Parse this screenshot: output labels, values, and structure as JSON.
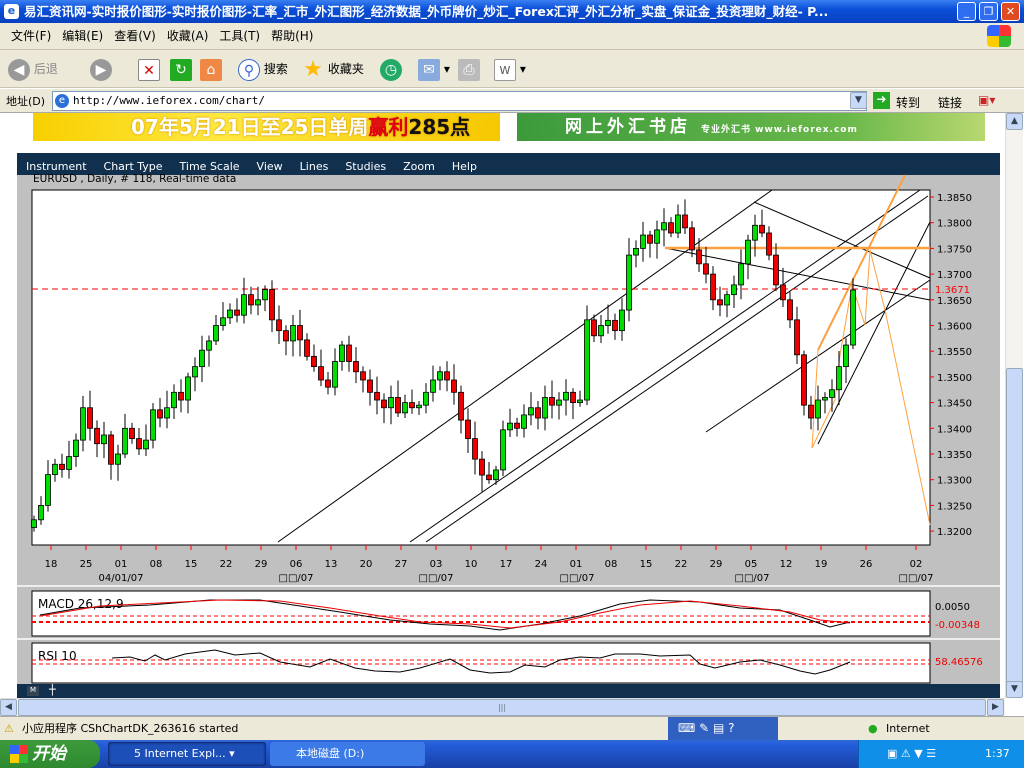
{
  "window": {
    "title": "易汇资讯网-实时报价图形-实时报价图形-汇率_汇市_外汇图形_经济数据_外币牌价_炒汇_Forex汇评_外汇分析_实盘_保证金_投资理财_财经- P...",
    "minimize": "_",
    "restore": "❐",
    "close": "✕"
  },
  "menu": [
    "文件(F)",
    "编辑(E)",
    "查看(V)",
    "收藏(A)",
    "工具(T)",
    "帮助(H)"
  ],
  "toolbar": {
    "back": "后退",
    "search": "搜索",
    "favorites": "收藏夹"
  },
  "address": {
    "label": "地址(D)",
    "url": "http://www.ieforex.com/chart/",
    "go": "转到",
    "links": "链接"
  },
  "banners": {
    "left_a": "07年5月21日至25日单周",
    "left_b": "赢利",
    "left_c": "285点",
    "right": "网上外汇书店",
    "right_small": "专业外汇书 www.ieforex.com"
  },
  "applet": {
    "menu": [
      "Instrument",
      "Chart Type",
      "Time Scale",
      "View",
      "Lines",
      "Studies",
      "Zoom",
      "Help"
    ],
    "info": "EURUSD , Daily, # 118, Real-time data",
    "current_price": "1.3671",
    "macd_label": "MACD 26,12,9",
    "macd_ticks": [
      "0.0050",
      "-0.00348"
    ],
    "rsi_label": "RSI 10",
    "rsi_value": "58.46576",
    "colors": {
      "up": "#00dd00",
      "down": "#ee0000",
      "fib": "#ffa040",
      "level": "#ff0000"
    }
  },
  "chart_data": {
    "type": "candlestick",
    "instrument": "EURUSD",
    "timeframe": "Daily",
    "ylim": [
      1.318,
      1.388
    ],
    "y_ticks": [
      "1.3850",
      "1.3800",
      "1.3750",
      "1.3700",
      "1.3650",
      "1.3600",
      "1.3550",
      "1.3500",
      "1.3450",
      "1.3400",
      "1.3350",
      "1.3300",
      "1.3250",
      "1.3200"
    ],
    "x_ticks": [
      "18",
      "25",
      "01",
      "08",
      "15",
      "22",
      "29",
      "06",
      "13",
      "20",
      "27",
      "03",
      "10",
      "17",
      "24",
      "01",
      "08",
      "15",
      "22",
      "29",
      "05",
      "12",
      "19",
      "26",
      "02"
    ],
    "x_month_labels": [
      "04/01/07",
      "□□/07",
      "□□/07",
      "□□/07",
      "□□/07",
      "□□/07"
    ],
    "closes": [
      1.3222,
      1.325,
      1.331,
      1.333,
      1.332,
      1.3345,
      1.3377,
      1.344,
      1.34,
      1.337,
      1.3387,
      1.333,
      1.335,
      1.34,
      1.338,
      1.336,
      1.3377,
      1.3436,
      1.342,
      1.344,
      1.347,
      1.3455,
      1.35,
      1.352,
      1.3552,
      1.357,
      1.36,
      1.3615,
      1.363,
      1.362,
      1.366,
      1.364,
      1.365,
      1.367,
      1.3611,
      1.359,
      1.357,
      1.36,
      1.3572,
      1.354,
      1.352,
      1.3494,
      1.348,
      1.353,
      1.3562,
      1.353,
      1.351,
      1.3494,
      1.347,
      1.3455,
      1.344,
      1.346,
      1.343,
      1.345,
      1.344,
      1.3445,
      1.347,
      1.3494,
      1.351,
      1.3494,
      1.347,
      1.3416,
      1.338,
      1.334,
      1.3309,
      1.33,
      1.3319,
      1.3397,
      1.341,
      1.34,
      1.3426,
      1.344,
      1.342,
      1.346,
      1.3445,
      1.3455,
      1.347,
      1.345,
      1.3455,
      1.3611,
      1.358,
      1.36,
      1.361,
      1.359,
      1.363,
      1.3737,
      1.375,
      1.3776,
      1.376,
      1.3786,
      1.38,
      1.378,
      1.3815,
      1.379,
      1.3747,
      1.372,
      1.37,
      1.365,
      1.364,
      1.366,
      1.3679,
      1.372,
      1.3766,
      1.3795,
      1.378,
      1.3737,
      1.3679,
      1.365,
      1.3611,
      1.3543,
      1.3445,
      1.342,
      1.3455,
      1.346,
      1.3475,
      1.352,
      1.3562,
      1.3669
    ]
  },
  "status": {
    "text": "小应用程序 CShChartDK_263616 started",
    "zone": "Internet"
  },
  "taskbar": {
    "start": "开始",
    "task1": "5 Internet Expl...",
    "task2": "本地磁盘 (D:)",
    "clock": "1:37"
  }
}
